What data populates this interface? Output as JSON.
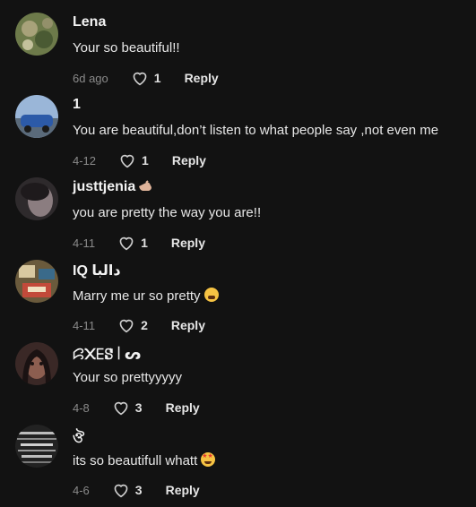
{
  "comments": [
    {
      "username": "Lena",
      "text": "Your so beautiful!!",
      "date": "6d ago",
      "likes": "1",
      "reply_label": "Reply",
      "avatar_colors": [
        "#6d7a4a",
        "#a8a27a"
      ]
    },
    {
      "username": "1",
      "text": "You are beautiful,don’t listen to what people say ,not even me",
      "date": "4-12",
      "likes": "1",
      "reply_label": "Reply",
      "avatar_colors": [
        "#2c5aa8",
        "#9ab6d8"
      ]
    },
    {
      "username": "justtjenia",
      "text": "you are pretty the way you are!!",
      "date": "4-11",
      "likes": "1",
      "reply_label": "Reply",
      "avatar_colors": [
        "#2e2a2c",
        "#8b7d80"
      ]
    },
    {
      "username": "IQ دالبا",
      "text": "Marry me ur so pretty",
      "date": "4-11",
      "likes": "2",
      "reply_label": "Reply",
      "avatar_colors": [
        "#6a5a3c",
        "#c24a3a"
      ]
    },
    {
      "username": "ꗱ᙭ꗋꗟ꒐ᔕ",
      "text": "Your so prettyyyyy",
      "date": "4-8",
      "likes": "3",
      "reply_label": "Reply",
      "avatar_colors": [
        "#3a2826",
        "#8c5e50"
      ]
    },
    {
      "username": "ঔ",
      "text": "its so beautifull whatt",
      "date": "4-6",
      "likes": "3",
      "reply_label": "Reply",
      "avatar_colors": [
        "#222222",
        "#bdbdbd"
      ]
    }
  ],
  "colors": {
    "background": "#121212",
    "meta_text": "#8a8a8a",
    "primary_text": "#ffffff"
  },
  "icons": {
    "like": "heart-outline-icon",
    "hand_emoji": "waving-hand-icon",
    "tired_emoji": "tired-face-emoji-icon",
    "starstruck_emoji": "star-struck-emoji-icon"
  }
}
